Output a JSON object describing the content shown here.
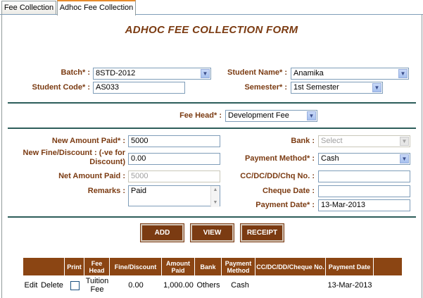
{
  "tabs": [
    {
      "label": "Fee Collection"
    },
    {
      "label": "Adhoc Fee Collection"
    }
  ],
  "form": {
    "title": "ADHOC FEE COLLECTION FORM",
    "batch_label": "Batch* :",
    "batch_value": "8STD-2012",
    "student_name_label": "Student Name* :",
    "student_name_value": "Anamika",
    "student_code_label": "Student Code* :",
    "student_code_value": "AS033",
    "semester_label": "Semester* :",
    "semester_value": "1st Semester",
    "fee_head_label": "Fee Head* :",
    "fee_head_value": "Development Fee",
    "new_amount_label": "New Amount Paid* :",
    "new_amount_value": "5000",
    "bank_label": "Bank :",
    "bank_value": "Select",
    "fine_label": "New Fine/Discount : (-ve for Discount)",
    "fine_value": "0.00",
    "payment_method_label": "Payment Method* :",
    "payment_method_value": "Cash",
    "net_amount_label": "Net Amount Paid :",
    "net_amount_value": "5000",
    "cc_label": "CC/DC/DD/Chq No. :",
    "cc_value": "",
    "remarks_label": "Remarks :",
    "remarks_value": "Paid",
    "cheque_date_label": "Cheque Date :",
    "cheque_date_value": "",
    "payment_date_label": "Payment Date* :",
    "payment_date_value": "13-Mar-2013"
  },
  "buttons": {
    "add": "ADD",
    "view": "VIEW",
    "receipt": "RECEIPT"
  },
  "table": {
    "headers": [
      "",
      "Print",
      "Fee Head",
      "Fine/Discount",
      "Amount Paid",
      "Bank",
      "Payment Method",
      "CC/DC/DD/Cheque No.",
      "Payment Date",
      ""
    ],
    "rows": [
      {
        "edit": "Edit",
        "delete": "Delete",
        "fee_head": "Tuition Fee",
        "fine": "0.00",
        "amount": "1,000.00",
        "bank": "Others",
        "method": "Cash",
        "cheque": "",
        "date": "13-Mar-2013"
      }
    ]
  }
}
